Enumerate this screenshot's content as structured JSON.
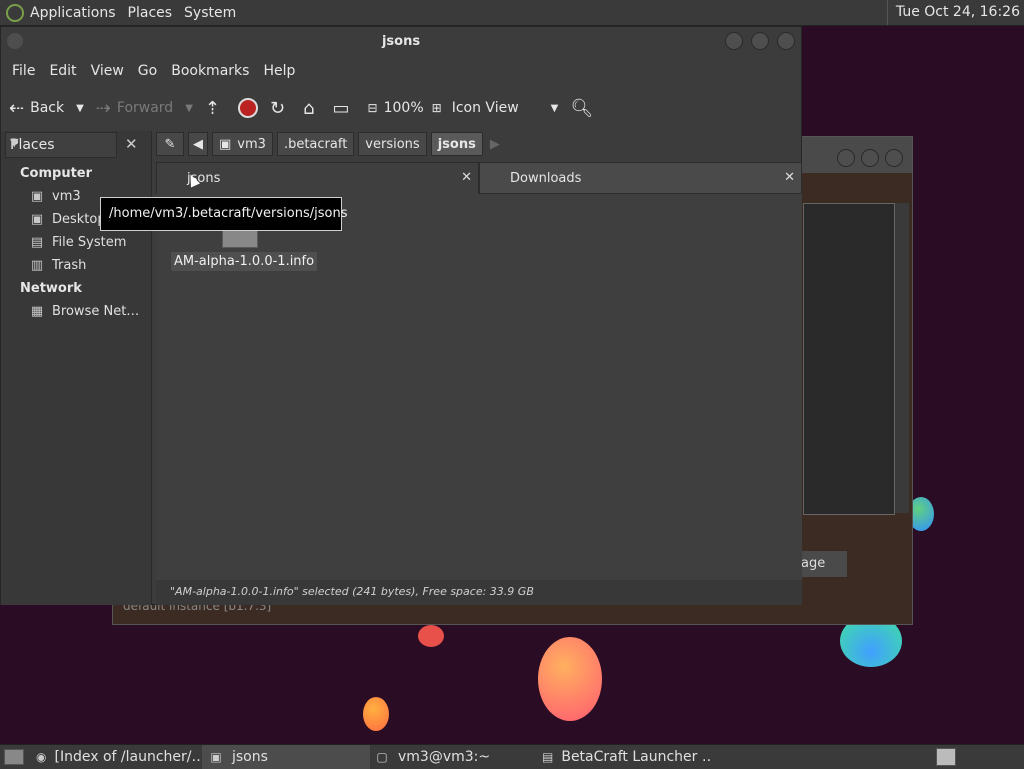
{
  "top_panel": {
    "menus": [
      "Applications",
      "Places",
      "System"
    ],
    "clock": "Tue Oct 24, 16:26"
  },
  "background_window": {
    "button_fragment": "age",
    "bottom_text": "default instance [b1.7.3]"
  },
  "window": {
    "title": "jsons",
    "menu": [
      "File",
      "Edit",
      "View",
      "Go",
      "Bookmarks",
      "Help"
    ],
    "toolbar": {
      "back": "Back",
      "forward": "Forward",
      "zoom": "100%",
      "view_mode": "Icon View"
    },
    "sidebar": {
      "header": "Places",
      "sections": [
        {
          "title": "Computer",
          "items": [
            {
              "label": "vm3",
              "icon": "home-folder-icon"
            },
            {
              "label": "Desktop",
              "icon": "desktop-folder-icon"
            },
            {
              "label": "File System",
              "icon": "drive-icon"
            },
            {
              "label": "Trash",
              "icon": "trash-icon"
            }
          ]
        },
        {
          "title": "Network",
          "items": [
            {
              "label": "Browse Net…",
              "icon": "network-icon"
            }
          ]
        }
      ]
    },
    "path": [
      "vm3",
      ".betacraft",
      "versions",
      "jsons"
    ],
    "tabs": [
      {
        "label": "jsons",
        "active": true
      },
      {
        "label": "Downloads",
        "active": false
      }
    ],
    "files": [
      {
        "name": "AM-alpha-1.0.0-1.info"
      }
    ],
    "tooltip": "/home/vm3/.betacraft/versions/jsons",
    "status": "\"AM-alpha-1.0.0-1.info\" selected (241 bytes), Free space: 33.9 GB"
  },
  "taskbar": {
    "tasks": [
      {
        "label": "[Index of /launcher/…",
        "icon": "chrome-icon"
      },
      {
        "label": "jsons",
        "icon": "folder-icon"
      },
      {
        "label": "vm3@vm3:~",
        "icon": "terminal-icon"
      },
      {
        "label": "BetaCraft Launcher …",
        "icon": "java-icon"
      }
    ]
  }
}
